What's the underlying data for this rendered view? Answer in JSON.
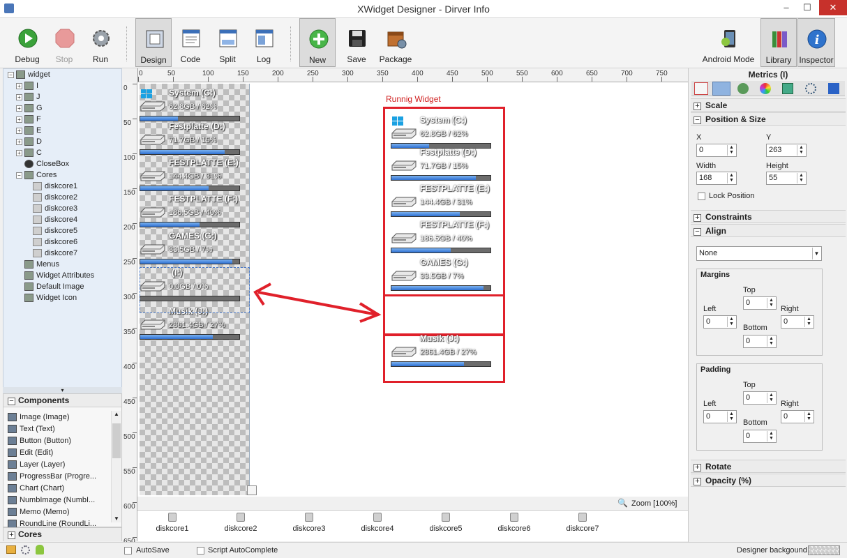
{
  "window": {
    "title": "XWidget Designer - Dirver Info",
    "minimize": "–",
    "maximize": "☐",
    "close": "✕"
  },
  "toolbar": {
    "debug": "Debug",
    "stop": "Stop",
    "run": "Run",
    "design": "Design",
    "code": "Code",
    "split": "Split",
    "log": "Log",
    "new": "New",
    "save": "Save",
    "package": "Package",
    "android_mode": "Android Mode",
    "library": "Library",
    "inspector": "Inspector"
  },
  "tree": {
    "items": [
      {
        "label": "widget",
        "icon": "layer-icon"
      },
      {
        "label": "I",
        "icon": "layer-icon"
      },
      {
        "label": "J",
        "icon": "layer-icon"
      },
      {
        "label": "G",
        "icon": "layer-icon"
      },
      {
        "label": "F",
        "icon": "layer-icon"
      },
      {
        "label": "E",
        "icon": "layer-icon"
      },
      {
        "label": "D",
        "icon": "layer-icon"
      },
      {
        "label": "C",
        "icon": "layer-icon"
      },
      {
        "label": "CloseBox",
        "icon": "close-icon"
      },
      {
        "label": "Cores",
        "icon": "cores-icon"
      },
      {
        "label": "diskcore1",
        "icon": "diskcore-icon"
      },
      {
        "label": "diskcore2",
        "icon": "diskcore-icon"
      },
      {
        "label": "diskcore3",
        "icon": "diskcore-icon"
      },
      {
        "label": "diskcore4",
        "icon": "diskcore-icon"
      },
      {
        "label": "diskcore5",
        "icon": "diskcore-icon"
      },
      {
        "label": "diskcore6",
        "icon": "diskcore-icon"
      },
      {
        "label": "diskcore7",
        "icon": "diskcore-icon"
      },
      {
        "label": "Menus",
        "icon": "menu-icon"
      },
      {
        "label": "Widget Attributes",
        "icon": "attributes-icon"
      },
      {
        "label": "Default Image",
        "icon": "image-icon"
      },
      {
        "label": "Widget Icon",
        "icon": "icon-icon"
      }
    ]
  },
  "components": {
    "header": "Components",
    "items": [
      "Image (Image)",
      "Text (Text)",
      "Button (Button)",
      "Edit (Edit)",
      "Layer (Layer)",
      "ProgressBar (Progre...",
      "Chart (Chart)",
      "NumbImage (NumbI...",
      "Memo (Memo)",
      "RoundLine (RoundLi..."
    ],
    "cores_header": "Cores"
  },
  "ruler": {
    "h": [
      "0",
      "50",
      "100",
      "150",
      "200",
      "250",
      "300",
      "350",
      "400",
      "450",
      "500",
      "550",
      "600",
      "650",
      "700",
      "750"
    ],
    "v": [
      "0",
      "50",
      "100",
      "150",
      "200",
      "250",
      "300",
      "350",
      "400",
      "450",
      "500",
      "550",
      "600",
      "650"
    ]
  },
  "design_drives": [
    {
      "name": "System (C:)",
      "info": "62.8GB  / 62%",
      "pct": 0.38,
      "win": true
    },
    {
      "name": "Festplatte (D:)",
      "info": "71.7GB  / 15%",
      "pct": 0.85,
      "win": false
    },
    {
      "name": "FESTPLATTE (E:)",
      "info": "144.4GB  / 31%",
      "pct": 0.69,
      "win": false
    },
    {
      "name": "FESTPLATTE (F:)",
      "info": "186.5GB  / 40%",
      "pct": 0.6,
      "win": false
    },
    {
      "name": "GAMES (G:)",
      "info": "33.5GB  / 7%",
      "pct": 0.93,
      "win": false
    },
    {
      "name": "(I:)",
      "info": "0.0GB  / 0%",
      "pct": 0.0,
      "win": false
    },
    {
      "name": "Musik (J:)",
      "info": "2861.4GB  / 27%",
      "pct": 0.73,
      "win": false
    }
  ],
  "running": {
    "label": "Runnig Widget",
    "drives": [
      {
        "name": "System (C:)",
        "info": "62.8GB  / 62%",
        "pct": 0.38,
        "win": true
      },
      {
        "name": "Festplatte (D:)",
        "info": "71.7GB  / 15%",
        "pct": 0.85,
        "win": false
      },
      {
        "name": "FESTPLATTE (E:)",
        "info": "144.4GB  / 31%",
        "pct": 0.69,
        "win": false
      },
      {
        "name": "FESTPLATTE (F:)",
        "info": "186.5GB  / 40%",
        "pct": 0.6,
        "win": false
      },
      {
        "name": "GAMES (G:)",
        "info": "33.5GB  / 7%",
        "pct": 0.93,
        "win": false
      },
      {
        "name": "Musik (J:)",
        "info": "2861.4GB  / 27%",
        "pct": 0.73,
        "win": false
      }
    ]
  },
  "zoom": "Zoom [100%]",
  "diskcores": [
    "diskcore1",
    "diskcore2",
    "diskcore3",
    "diskcore4",
    "diskcore5",
    "diskcore6",
    "diskcore7"
  ],
  "inspector": {
    "title": "Metrics (I)",
    "scale": "Scale",
    "position_size": "Position & Size",
    "x_label": "X",
    "x_value": "0",
    "y_label": "Y",
    "y_value": "263",
    "width_label": "Width",
    "width_value": "168",
    "height_label": "Height",
    "height_value": "55",
    "lock_position": "Lock Position",
    "constraints": "Constraints",
    "align": "Align",
    "align_value": "None",
    "margins": "Margins",
    "padding": "Padding",
    "top": "Top",
    "left": "Left",
    "right": "Right",
    "bottom": "Bottom",
    "zero": "0",
    "rotate": "Rotate",
    "opacity": "Opacity (%)"
  },
  "statusbar": {
    "autosave": "AutoSave",
    "script_autocomplete": "Script AutoComplete",
    "designer_background": "Designer backgound"
  }
}
